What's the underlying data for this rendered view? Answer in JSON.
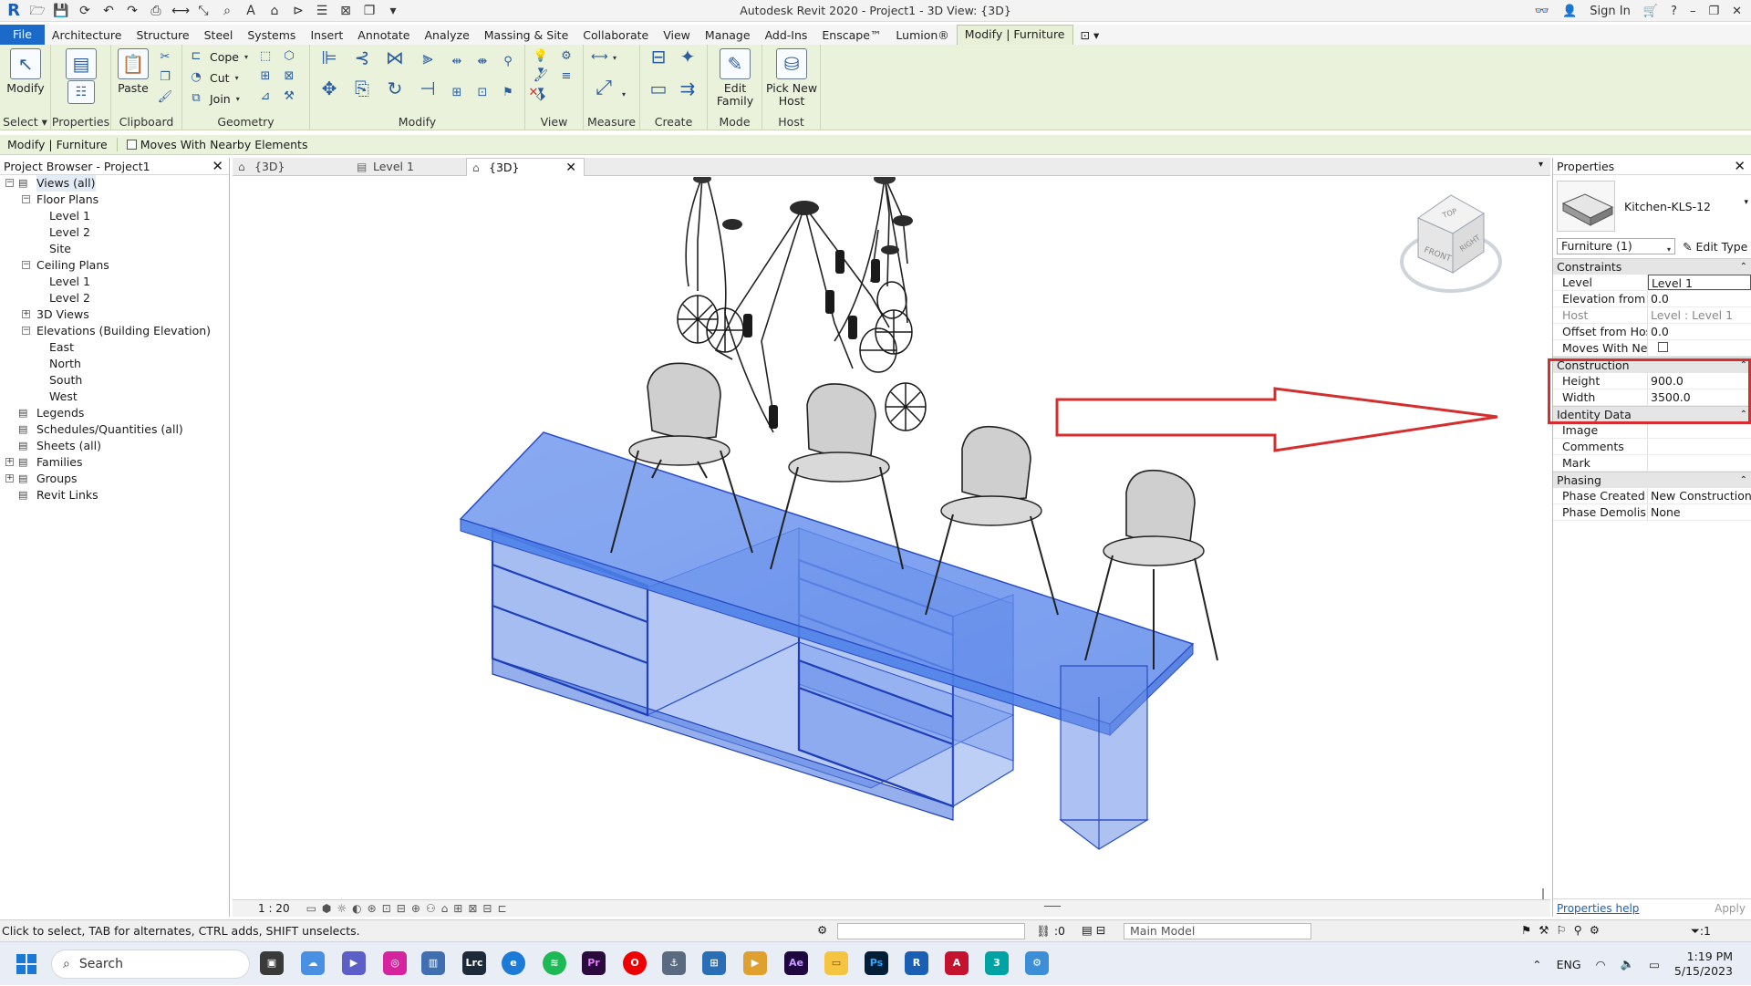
{
  "titlebar": {
    "logo": "R",
    "title": "Autodesk Revit 2020 - Project1 - 3D View: {3D}",
    "sign_in": "Sign In"
  },
  "ribbon_tabs": [
    "File",
    "Architecture",
    "Structure",
    "Steel",
    "Systems",
    "Insert",
    "Annotate",
    "Analyze",
    "Massing & Site",
    "Collaborate",
    "View",
    "Manage",
    "Add-Ins",
    "Enscape™",
    "Lumion®",
    "Modify | Furniture"
  ],
  "ribbon": {
    "select": {
      "modify": "Modify",
      "label": "Select"
    },
    "properties": {
      "button": "Properties",
      "label": "Properties"
    },
    "clipboard": {
      "paste": "Paste",
      "label": "Clipboard"
    },
    "geometry": {
      "cope": "Cope",
      "cut": "Cut",
      "join": "Join",
      "label": "Geometry"
    },
    "modify": {
      "label": "Modify"
    },
    "view": {
      "label": "View"
    },
    "measure": {
      "label": "Measure"
    },
    "create": {
      "label": "Create"
    },
    "mode": {
      "edit_family": "Edit Family",
      "label": "Mode"
    },
    "host": {
      "pick_new_host": "Pick New Host",
      "label": "Host"
    }
  },
  "options_bar": {
    "context": "Modify | Furniture",
    "moves_with_nearby": "Moves With Nearby Elements",
    "moves_with_nearby_checked": false
  },
  "project_browser": {
    "title": "Project Browser - Project1",
    "tree": [
      {
        "label": "Views (all)",
        "depth": 0,
        "toggle": "−",
        "icon": "views-icon",
        "selected": true
      },
      {
        "label": "Floor Plans",
        "depth": 1,
        "toggle": "−"
      },
      {
        "label": "Level 1",
        "depth": 2
      },
      {
        "label": "Level 2",
        "depth": 2
      },
      {
        "label": "Site",
        "depth": 2
      },
      {
        "label": "Ceiling Plans",
        "depth": 1,
        "toggle": "−"
      },
      {
        "label": "Level 1",
        "depth": 2
      },
      {
        "label": "Level 2",
        "depth": 2
      },
      {
        "label": "3D Views",
        "depth": 1,
        "toggle": "+"
      },
      {
        "label": "Elevations (Building Elevation)",
        "depth": 1,
        "toggle": "−"
      },
      {
        "label": "East",
        "depth": 2
      },
      {
        "label": "North",
        "depth": 2
      },
      {
        "label": "South",
        "depth": 2
      },
      {
        "label": "West",
        "depth": 2
      },
      {
        "label": "Legends",
        "depth": 0,
        "icon": "legends-icon"
      },
      {
        "label": "Schedules/Quantities (all)",
        "depth": 0,
        "icon": "schedules-icon"
      },
      {
        "label": "Sheets (all)",
        "depth": 0,
        "icon": "sheets-icon"
      },
      {
        "label": "Families",
        "depth": 0,
        "toggle": "+",
        "icon": "families-icon"
      },
      {
        "label": "Groups",
        "depth": 0,
        "toggle": "+",
        "icon": "groups-icon"
      },
      {
        "label": "Revit Links",
        "depth": 0,
        "icon": "links-icon"
      }
    ]
  },
  "view_tabs": [
    {
      "label": "{3D}",
      "active": false
    },
    {
      "label": "Level 1",
      "active": false
    },
    {
      "label": "{3D}",
      "active": true
    }
  ],
  "view_control": {
    "scale": "1 : 20"
  },
  "viewcube": {
    "top": "TOP",
    "front": "FRONT",
    "right": "RIGHT"
  },
  "properties": {
    "title": "Properties",
    "type_name": "Kitchen-KLS-12",
    "instance_filter": "Furniture (1)",
    "edit_type": "Edit Type",
    "groups": [
      {
        "name": "Constraints",
        "rows": [
          {
            "name": "Level",
            "value": "Level 1",
            "boxed": true
          },
          {
            "name": "Elevation from ...",
            "value": "0.0"
          },
          {
            "name": "Host",
            "value": "Level : Level 1",
            "dim": true
          },
          {
            "name": "Offset from Host",
            "value": "0.0"
          },
          {
            "name": "Moves With Ne...",
            "value": "",
            "checkbox": true
          }
        ]
      },
      {
        "name": "Construction",
        "rows": [
          {
            "name": "Height",
            "value": "900.0"
          },
          {
            "name": "Width",
            "value": "3500.0"
          }
        ]
      },
      {
        "name": "Identity Data",
        "rows": [
          {
            "name": "Image",
            "value": ""
          },
          {
            "name": "Comments",
            "value": ""
          },
          {
            "name": "Mark",
            "value": ""
          }
        ]
      },
      {
        "name": "Phasing",
        "rows": [
          {
            "name": "Phase Created",
            "value": "New Construction"
          },
          {
            "name": "Phase Demolish...",
            "value": "None"
          }
        ]
      }
    ],
    "help_link": "Properties help",
    "apply": "Apply"
  },
  "status_bar": {
    "message": "Click to select, TAB for alternates, CTRL adds, SHIFT unselects.",
    "selection_count": ":0",
    "model": "Main Model",
    "filter_count": ":1"
  },
  "taskbar": {
    "search": "Search",
    "language": "ENG",
    "time": "1:19 PM",
    "date": "5/15/2023",
    "apps": [
      "Lrc",
      "Pr",
      "Ae",
      "Ps",
      "R",
      "A",
      "3"
    ]
  },
  "colors": {
    "accent": "#1b6ac9",
    "ribbon_bg": "#eaf2dc",
    "highlight": "#d42e2e",
    "selection_blue": "#4d7fe8"
  }
}
